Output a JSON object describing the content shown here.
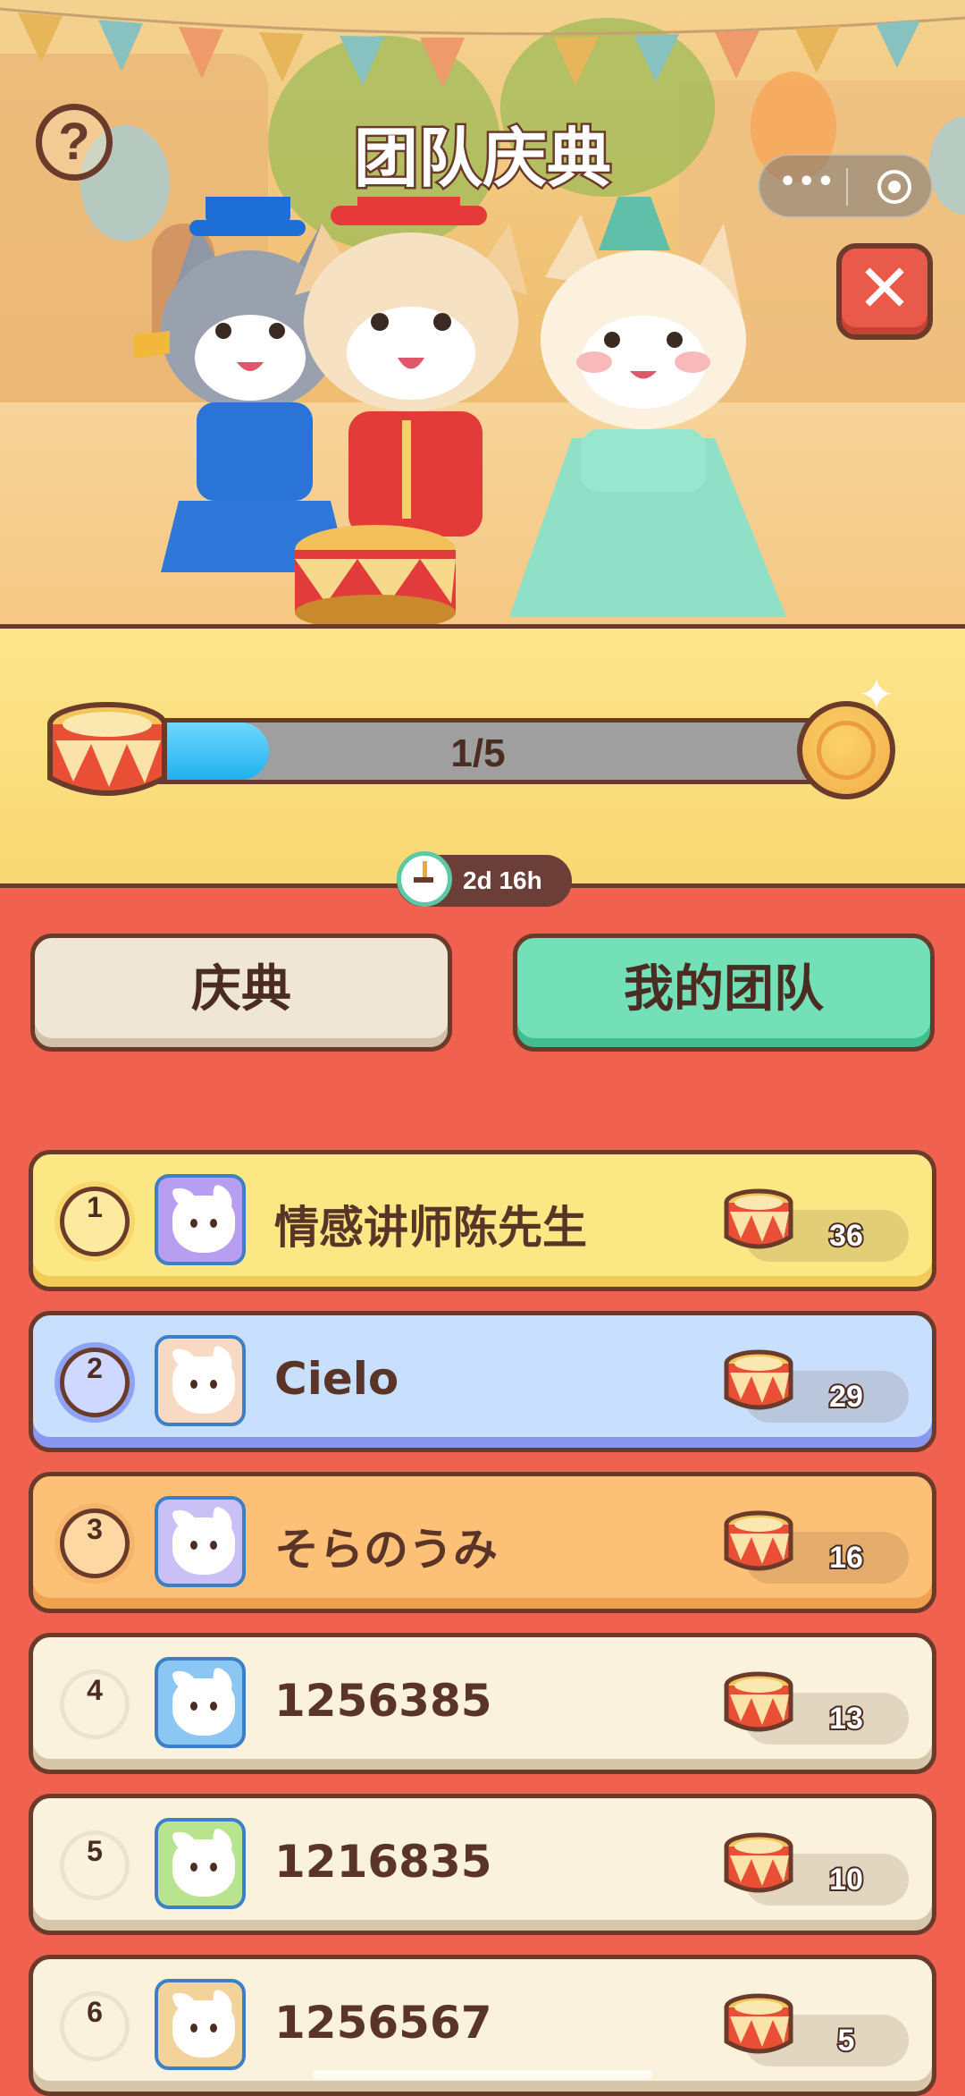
{
  "header": {
    "title": "团队庆典",
    "help_icon": "question-icon",
    "close_icon": "close-icon"
  },
  "progress": {
    "current": 1,
    "total": 5,
    "label": "1/5",
    "fill_fraction": 0.2
  },
  "timer": {
    "remaining": "2d 16h"
  },
  "tabs": [
    {
      "label": "庆典",
      "active": false
    },
    {
      "label": "我的团队",
      "active": true
    }
  ],
  "leaderboard": [
    {
      "rank": "1",
      "name": "情感讲师陈先生",
      "score": "36",
      "avatar_color": "#b89ef0"
    },
    {
      "rank": "2",
      "name": "Cielo",
      "score": "29",
      "avatar_color": "#f7d9c4"
    },
    {
      "rank": "3",
      "name": "そらのうみ",
      "score": "16",
      "avatar_color": "#c9c1f5"
    },
    {
      "rank": "4",
      "name": "1256385",
      "score": "13",
      "avatar_color": "#8cc6f2"
    },
    {
      "rank": "5",
      "name": "1216835",
      "score": "10",
      "avatar_color": "#b9e48f"
    },
    {
      "rank": "6",
      "name": "1256567",
      "score": "5",
      "avatar_color": "#f4d39a"
    }
  ],
  "colors": {
    "background": "#f0614f",
    "outline": "#6a3a2a",
    "active_tab": "#74e0b7",
    "progress_fill": "#1fb1ee"
  }
}
